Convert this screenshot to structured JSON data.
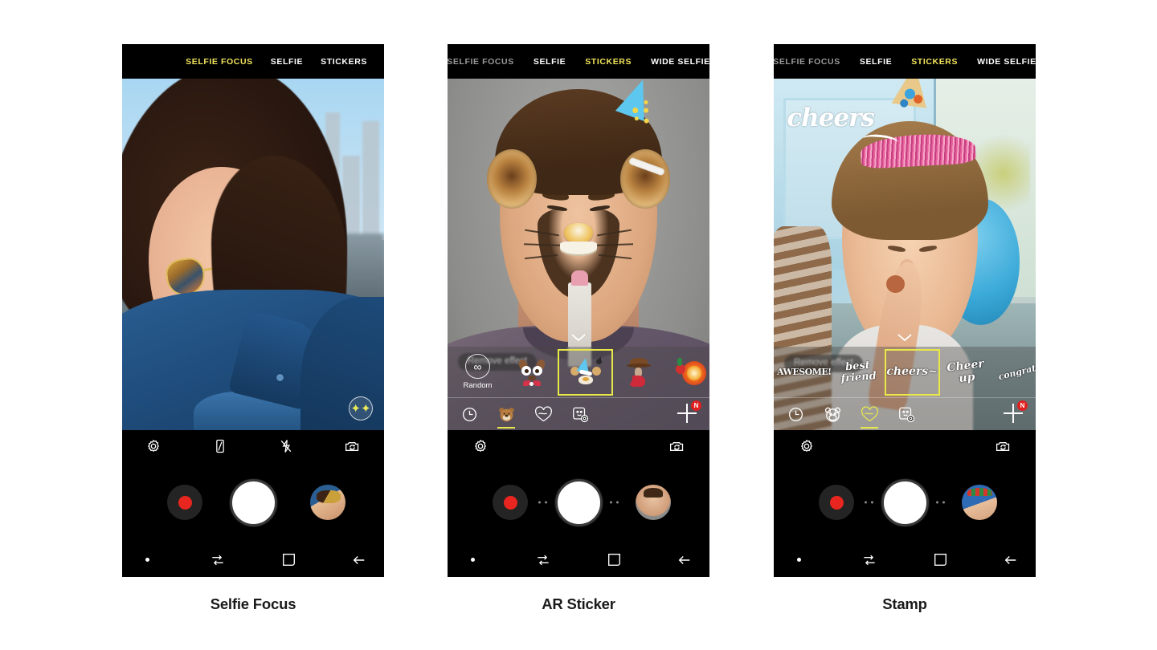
{
  "phones": [
    {
      "id": "selfie-focus",
      "caption": "Selfie Focus",
      "modes": [
        {
          "label": "SELFIE FOCUS",
          "state": "active"
        },
        {
          "label": "SELFIE",
          "state": "normal"
        },
        {
          "label": "STICKERS",
          "state": "normal"
        }
      ],
      "effect_badge": "sparkle-icon",
      "controls": {
        "icons": [
          "settings-icon",
          "screen-flash-icon",
          "flash-off-icon",
          "switch-camera-icon"
        ],
        "record_label": "record",
        "shutter_label": "shutter",
        "gallery_label": "gallery-thumbnail"
      },
      "navbar": [
        "recents-dot",
        "recents-icon",
        "home-icon",
        "back-icon"
      ]
    },
    {
      "id": "ar-sticker",
      "caption": "AR Sticker",
      "modes": [
        {
          "label": "SELFIE FOCUS",
          "state": "dim"
        },
        {
          "label": "SELFIE",
          "state": "normal"
        },
        {
          "label": "STICKERS",
          "state": "active"
        },
        {
          "label": "WIDE SELFIE",
          "state": "normal"
        }
      ],
      "remove_effect": "Remove effect",
      "tray": {
        "random_label": "Random",
        "random_icon": "infinity-icon",
        "items": [
          {
            "name": "dog-glasses-sticker",
            "selected": false
          },
          {
            "name": "bear-party-hat-sticker",
            "selected": true
          },
          {
            "name": "cowboy-sticker",
            "selected": false
          },
          {
            "name": "firework-sticker",
            "selected": false
          }
        ],
        "tabs": [
          {
            "name": "recent-tab",
            "icon": "clock-icon",
            "active": false
          },
          {
            "name": "ar-sticker-tab",
            "icon": "bear-icon",
            "active": true
          },
          {
            "name": "stamp-tab",
            "icon": "heart-script-icon",
            "active": false
          },
          {
            "name": "manage-tab",
            "icon": "smiley-gear-icon",
            "active": false
          }
        ],
        "add_label": "+",
        "add_badge": "N"
      },
      "controls": {
        "icons": [
          "settings-icon",
          "switch-camera-icon"
        ],
        "record_label": "record",
        "shutter_label": "shutter",
        "gallery_label": "gallery-thumbnail"
      },
      "navbar": [
        "recents-dot",
        "recents-icon",
        "home-icon",
        "back-icon"
      ]
    },
    {
      "id": "stamp",
      "caption": "Stamp",
      "modes": [
        {
          "label": "SELFIE FOCUS",
          "state": "dim"
        },
        {
          "label": "SELFIE",
          "state": "normal"
        },
        {
          "label": "STICKERS",
          "state": "active"
        },
        {
          "label": "WIDE SELFIE",
          "state": "normal"
        }
      ],
      "remove_effect": "Remove effect",
      "overlay_stamp": "cheers",
      "tray": {
        "items": [
          {
            "name": "awesome-stamp",
            "text": "AWESOME!",
            "selected": false
          },
          {
            "name": "best-friend-stamp",
            "text": "best\nfriend",
            "selected": false
          },
          {
            "name": "cheers-stamp",
            "text": "cheers~",
            "selected": true
          },
          {
            "name": "cheer-up-stamp",
            "text": "Cheer up",
            "selected": false
          },
          {
            "name": "congratulations-stamp",
            "text": "congrats",
            "selected": false
          }
        ],
        "tabs": [
          {
            "name": "recent-tab",
            "icon": "clock-icon",
            "active": false
          },
          {
            "name": "ar-sticker-tab",
            "icon": "bear-icon",
            "active": false
          },
          {
            "name": "stamp-tab",
            "icon": "heart-script-icon",
            "active": true
          },
          {
            "name": "manage-tab",
            "icon": "smiley-gear-icon",
            "active": false
          }
        ],
        "add_label": "+",
        "add_badge": "N"
      },
      "controls": {
        "icons": [
          "settings-icon",
          "switch-camera-icon"
        ],
        "record_label": "record",
        "shutter_label": "shutter",
        "gallery_label": "gallery-thumbnail"
      },
      "navbar": [
        "recents-dot",
        "recents-icon",
        "home-icon",
        "back-icon"
      ]
    }
  ],
  "colors": {
    "accent_yellow": "#f2e45c",
    "record_red": "#e8261f",
    "badge_red": "#e02020",
    "selection_yellow": "#e9e84a",
    "background": "#ffffff",
    "phone_black": "#000000"
  }
}
